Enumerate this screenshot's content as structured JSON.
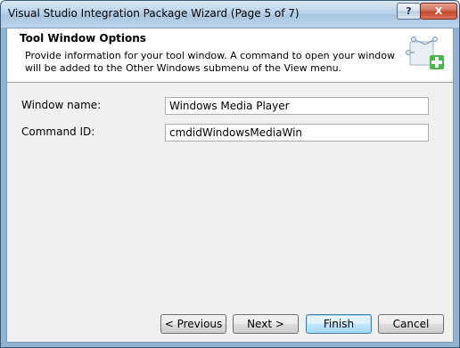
{
  "window": {
    "title": "Visual Studio Integration Package Wizard (Page 5 of 7)",
    "help_label": "?",
    "close_label": "X"
  },
  "header": {
    "title": "Tool Window Options",
    "description": "Provide information for your tool window. A command to open your window will be added to the Other Windows submenu of the View menu.",
    "icon": "wizard-add-icon"
  },
  "form": {
    "window_name_label": "Window name:",
    "window_name_value": "Windows Media Player",
    "command_id_label": "Command ID:",
    "command_id_value": "cmdidWindowsMediaWin"
  },
  "buttons": {
    "previous": "< Previous",
    "next": "Next >",
    "finish": "Finish",
    "cancel": "Cancel"
  },
  "colors": {
    "titlebar": "#b9d1e8",
    "dialog_bg": "#f0f0f0",
    "header_bg": "#ffffff",
    "default_button": "#bee6fd"
  }
}
